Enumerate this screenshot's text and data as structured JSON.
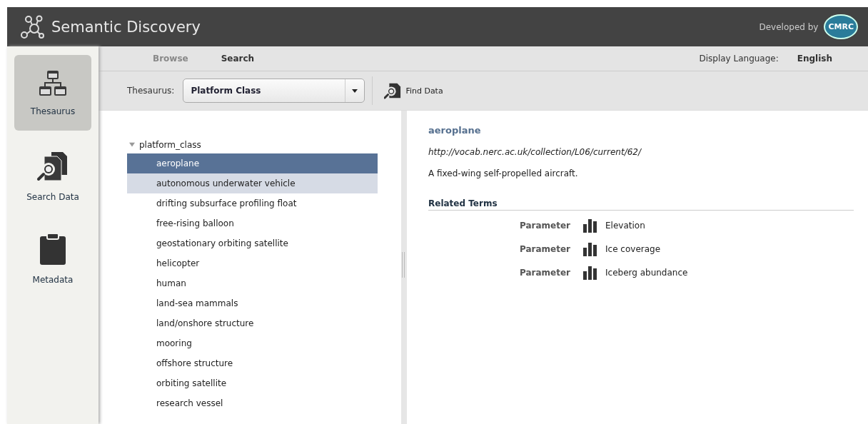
{
  "header": {
    "title": "Semantic Discovery",
    "credit": "Developed by",
    "logo_text": "CMRC"
  },
  "sidebar": {
    "items": [
      {
        "label": "Thesaurus",
        "kind": "thesaurus",
        "selected": true
      },
      {
        "label": "Search Data",
        "kind": "search",
        "selected": false
      },
      {
        "label": "Metadata",
        "kind": "metadata",
        "selected": false
      }
    ]
  },
  "tabs": [
    {
      "label": "Browse",
      "selected": false
    },
    {
      "label": "Search",
      "selected": true
    }
  ],
  "display_language": {
    "label": "Display Language:",
    "value": "English"
  },
  "toolbar": {
    "thesaurus_label": "Thesaurus:",
    "thesaurus_value": "Platform Class",
    "find_button": "Find Data"
  },
  "tree": {
    "label": "platform_class",
    "expanded": true,
    "children": [
      {
        "label": "aeroplane",
        "selected": true,
        "hovered": false
      },
      {
        "label": "autonomous underwater vehicle",
        "selected": false,
        "hovered": true
      },
      {
        "label": "drifting subsurface profiling float",
        "selected": false,
        "hovered": false
      },
      {
        "label": "free-rising balloon",
        "selected": false,
        "hovered": false
      },
      {
        "label": "geostationary orbiting satellite",
        "selected": false,
        "hovered": false
      },
      {
        "label": "helicopter",
        "selected": false,
        "hovered": false
      },
      {
        "label": "human",
        "selected": false,
        "hovered": false
      },
      {
        "label": "land-sea mammals",
        "selected": false,
        "hovered": false
      },
      {
        "label": "land/onshore structure",
        "selected": false,
        "hovered": false
      },
      {
        "label": "mooring",
        "selected": false,
        "hovered": false
      },
      {
        "label": "offshore structure",
        "selected": false,
        "hovered": false
      },
      {
        "label": "orbiting satellite",
        "selected": false,
        "hovered": false
      },
      {
        "label": "research vessel",
        "selected": false,
        "hovered": false
      }
    ]
  },
  "detail": {
    "title": "aeroplane",
    "uri": "http://vocab.nerc.ac.uk/collection/L06/current/62/",
    "definition": "A fixed-wing self-propelled aircraft.",
    "related_heading": "Related Terms",
    "related": [
      {
        "type": "Parameter",
        "term": "Elevation"
      },
      {
        "type": "Parameter",
        "term": "Ice coverage"
      },
      {
        "type": "Parameter",
        "term": "Iceberg abundance"
      }
    ]
  }
}
